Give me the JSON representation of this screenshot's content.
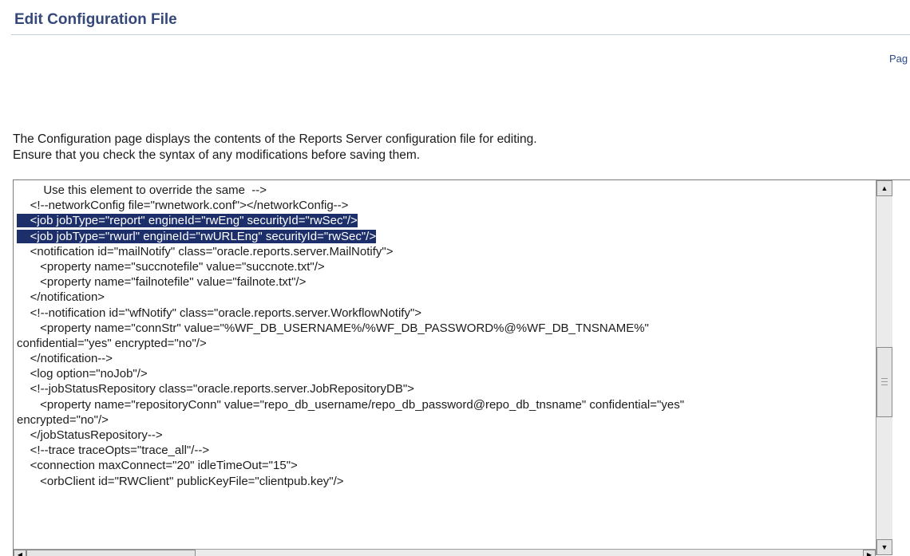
{
  "header": {
    "title": "Edit Configuration File",
    "page_link": "Pag"
  },
  "description": {
    "line1": "The Configuration page displays the contents of the Reports Server configuration file for editing.",
    "line2": "Ensure that you check the syntax of any modifications before saving them."
  },
  "editor": {
    "lines": [
      {
        "text": "        Use this element to override the same  -->",
        "selected": false
      },
      {
        "text": "    <!--networkConfig file=\"rwnetwork.conf\"></networkConfig-->",
        "selected": false
      },
      {
        "text": "    <job jobType=\"report\" engineId=\"rwEng\" securityId=\"rwSec\"/>",
        "selected": true
      },
      {
        "text": "    <job jobType=\"rwurl\" engineId=\"rwURLEng\" securityId=\"rwSec\"/>",
        "selected": true
      },
      {
        "text": "    <notification id=\"mailNotify\" class=\"oracle.reports.server.MailNotify\">",
        "selected": false
      },
      {
        "text": "       <property name=\"succnotefile\" value=\"succnote.txt\"/>",
        "selected": false
      },
      {
        "text": "       <property name=\"failnotefile\" value=\"failnote.txt\"/>",
        "selected": false
      },
      {
        "text": "    </notification>",
        "selected": false
      },
      {
        "text": "    <!--notification id=\"wfNotify\" class=\"oracle.reports.server.WorkflowNotify\">",
        "selected": false
      },
      {
        "text": "       <property name=\"connStr\" value=\"%WF_DB_USERNAME%/%WF_DB_PASSWORD%@%WF_DB_TNSNAME%\"",
        "selected": false
      },
      {
        "text": "confidential=\"yes\" encrypted=\"no\"/>",
        "selected": false
      },
      {
        "text": "    </notification-->",
        "selected": false
      },
      {
        "text": "    <log option=\"noJob\"/>",
        "selected": false
      },
      {
        "text": "    <!--jobStatusRepository class=\"oracle.reports.server.JobRepositoryDB\">",
        "selected": false
      },
      {
        "text": "       <property name=\"repositoryConn\" value=\"repo_db_username/repo_db_password@repo_db_tnsname\" confidential=\"yes\"",
        "selected": false
      },
      {
        "text": "encrypted=\"no\"/>",
        "selected": false
      },
      {
        "text": "    </jobStatusRepository-->",
        "selected": false
      },
      {
        "text": "    <!--trace traceOpts=\"trace_all\"/-->",
        "selected": false
      },
      {
        "text": "    <connection maxConnect=\"20\" idleTimeOut=\"15\">",
        "selected": false
      },
      {
        "text": "       <orbClient id=\"RWClient\" publicKeyFile=\"clientpub.key\"/>",
        "selected": false
      }
    ],
    "scrollbar": {
      "up_icon": "arrow-up-icon",
      "down_icon": "arrow-down-icon",
      "left_icon": "arrow-left-icon",
      "right_icon": "arrow-right-icon",
      "vertical_position": 0.55
    }
  },
  "colors": {
    "title": "#35487a",
    "selection_background": "#1c2f6b",
    "selection_text": "#ffffff"
  }
}
